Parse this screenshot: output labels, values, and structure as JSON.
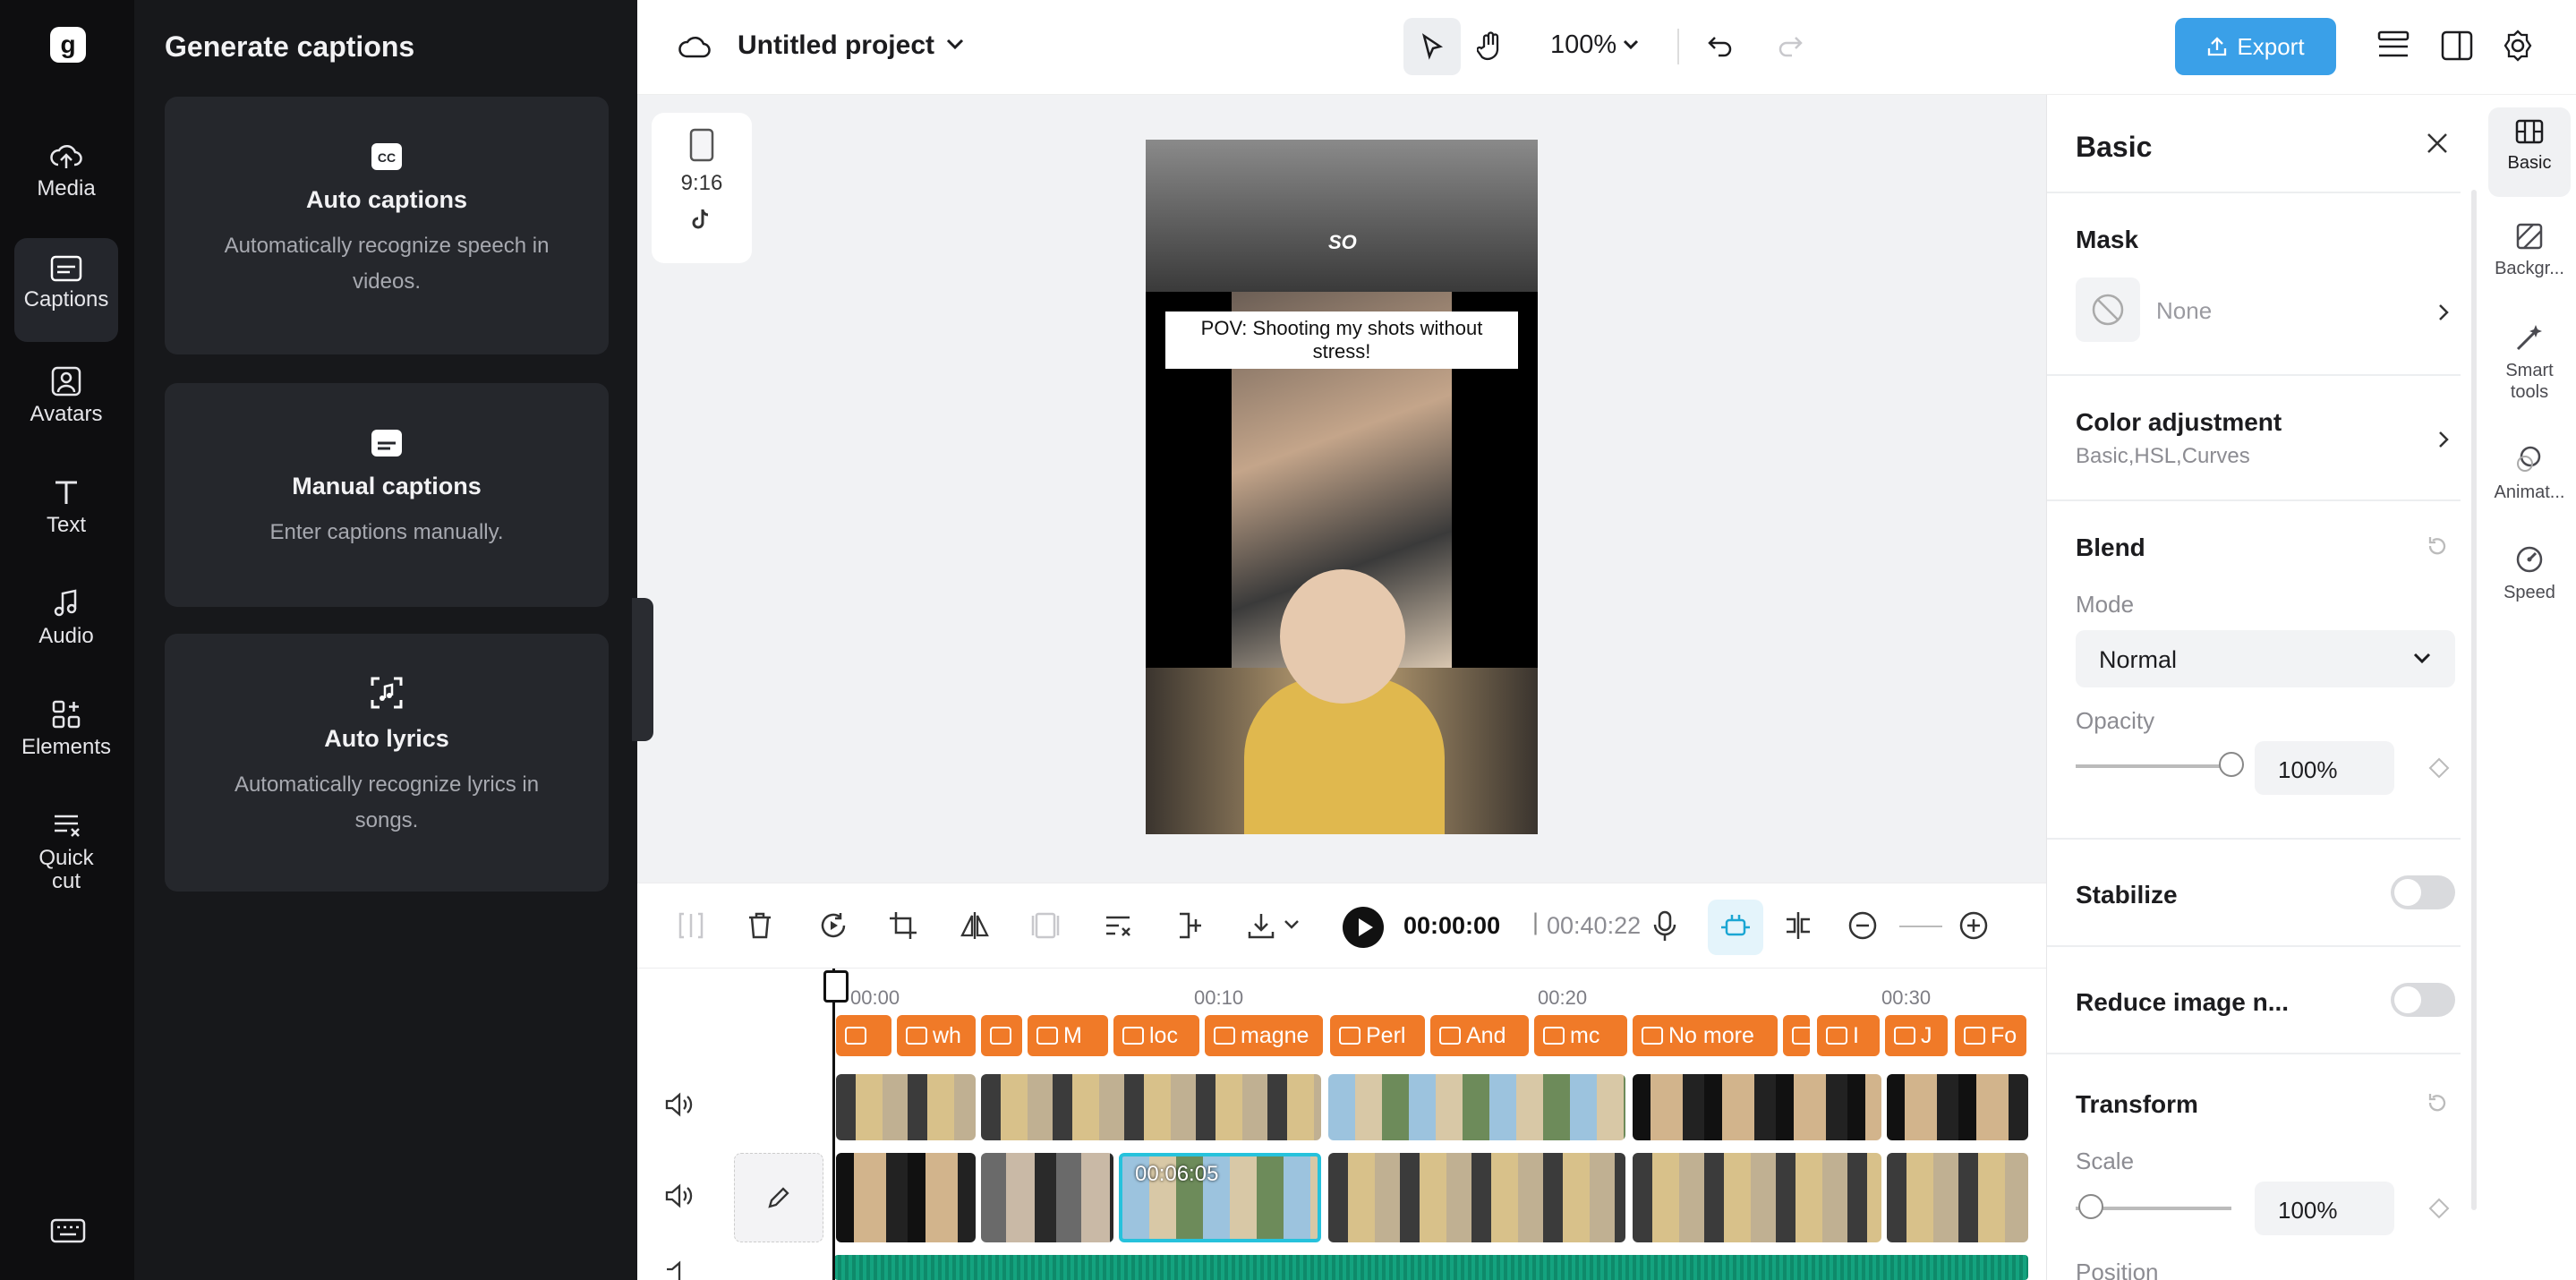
{
  "nav": {
    "items": [
      {
        "label": "Media",
        "icon": "cloud-upload-icon"
      },
      {
        "label": "Captions",
        "icon": "captions-icon",
        "active": true
      },
      {
        "label": "Avatars",
        "icon": "avatar-icon"
      },
      {
        "label": "Text",
        "icon": "text-icon"
      },
      {
        "label": "Audio",
        "icon": "music-note-icon"
      },
      {
        "label": "Elements",
        "icon": "elements-icon"
      },
      {
        "label": "Quick cut",
        "icon": "quick-cut-icon"
      }
    ]
  },
  "captions_panel": {
    "title": "Generate captions",
    "cards": [
      {
        "title": "Auto captions",
        "description": "Automatically recognize speech in videos.",
        "icon": "cc-icon"
      },
      {
        "title": "Manual captions",
        "description": "Enter captions manually.",
        "icon": "subtitle-icon"
      },
      {
        "title": "Auto lyrics",
        "description": "Automatically recognize lyrics in songs.",
        "icon": "lyrics-icon"
      }
    ]
  },
  "topbar": {
    "project_name": "Untitled project",
    "zoom": "100%",
    "export_label": "Export"
  },
  "canvas": {
    "ratio": "9:16",
    "overlay_word": "SO",
    "caption_text": "POV: Shooting my shots without stress!"
  },
  "props": {
    "title": "Basic",
    "mask": {
      "label": "Mask",
      "value": "None"
    },
    "color_adjustment": {
      "label": "Color adjustment",
      "sub": "Basic,HSL,Curves"
    },
    "blend": {
      "label": "Blend",
      "mode_label": "Mode",
      "mode_value": "Normal",
      "opacity_label": "Opacity",
      "opacity_value": "100%",
      "opacity_level": 1.0
    },
    "stabilize": {
      "label": "Stabilize",
      "on": false
    },
    "reduce_noise": {
      "label": "Reduce image n...",
      "on": false
    },
    "transform": {
      "label": "Transform",
      "scale_label": "Scale",
      "scale_value": "100%",
      "scale_level": 0.1,
      "position_label": "Position"
    }
  },
  "rail": {
    "items": [
      {
        "label": "Basic",
        "active": true
      },
      {
        "label": "Backgr..."
      },
      {
        "label": "Smart tools"
      },
      {
        "label": "Animat..."
      },
      {
        "label": "Speed"
      }
    ]
  },
  "playback": {
    "current_time": "00:00:00",
    "separator": "|",
    "duration": "00:40:22"
  },
  "timeline": {
    "ruler": [
      "00:00",
      "00:10",
      "00:20",
      "00:30"
    ],
    "caption_clips": [
      "",
      "wh",
      "",
      "M",
      "loc",
      "magne",
      "Perl",
      "And",
      "mc",
      "No more",
      "",
      "I",
      "J",
      "Fo"
    ],
    "selected_clip_time": "00:06:05"
  },
  "colors": {
    "accent": "#3aa0e8",
    "caption_clip": "#f07a28",
    "selection": "#26c2dc",
    "audio": "#14a37f"
  }
}
